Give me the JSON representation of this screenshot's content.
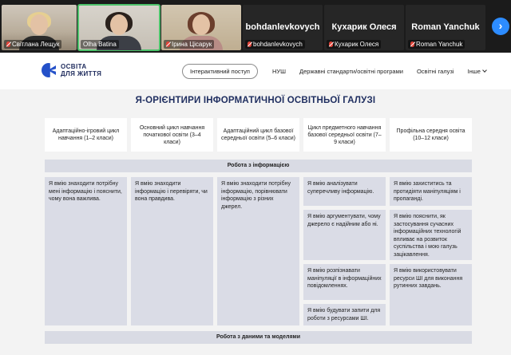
{
  "participants": [
    {
      "name": "Світлана Лещук",
      "muted": true,
      "video": true
    },
    {
      "name": "Olha Batina",
      "muted": false,
      "video": true,
      "active": true
    },
    {
      "name": "Ірина Цісарук",
      "muted": true,
      "video": true
    },
    {
      "name": "bohdanlevkovych",
      "label": "bohdanlevkovych",
      "muted": true,
      "video": false
    },
    {
      "name": "Кухарик Олеся",
      "label": "Кухарик Олеся",
      "muted": true,
      "video": false
    },
    {
      "name": "Roman Yanchuk",
      "label": "Roman Yanchuk",
      "muted": true,
      "video": false
    }
  ],
  "strip": {
    "next_icon": "chevron-right-icon",
    "accent": "#2d8cff"
  },
  "site": {
    "logo_line1": "ОСВІТА",
    "logo_line2": "ДЛЯ ЖИТТЯ",
    "nav": [
      "Інтерактивний поступ",
      "НУШ",
      "Державні стандарти/освітні програми",
      "Освітні галузі",
      "Інше"
    ]
  },
  "page_title": "Я-ОРІЄНТИРИ ІНФОРМАТИЧНОЇ ОСВІТНЬОЇ ГАЛУЗІ",
  "columns": [
    "Адаптаційно-ігровий цикл навчання (1–2 класи)",
    "Основний цикл навчання початкової освіти (3–4 класи)",
    "Адаптаційний цикл базової середньої освіти (5–6 класи)",
    "Цикл предметного навчання базової середньої освіти (7–9 класи)",
    "Профільна середня освіта (10–12 класи)"
  ],
  "sections": [
    {
      "title": "Робота з інформацією"
    },
    {
      "title": "Робота з даними та моделями"
    }
  ],
  "cells": {
    "c1": "Я вмію знаходити потрібну мені інформацію і пояснити, чому вона важлива.",
    "c2": "Я вмію знаходити інформацію і перевіряти, чи вона правдива.",
    "c3": "Я вмію знаходити потрібну інформацію, порівнювати інформацію з різних джерел.",
    "c4a": "Я вмію аналізувати суперечливу інформацію.",
    "c4b": "Я вмію аргументувати, чому джерело є надійним або ні.",
    "c4c": "Я вмію розпізнавати маніпуляції в інформаційних повідомленнях.",
    "c4d": "Я вмію будувати запити для роботи з ресурсами ШІ.",
    "c5a": "Я вмію захиститись та протидіяти маніпуляціям і пропаганді.",
    "c5b": "Я вмію пояснити, як застосування сучасних інформаційних технологій впливає на розвиток суспільства і мою галузь зацікавлення.",
    "c5c": "Я вмію використовувати ресурси ШІ для виконання рутинних завдань."
  }
}
